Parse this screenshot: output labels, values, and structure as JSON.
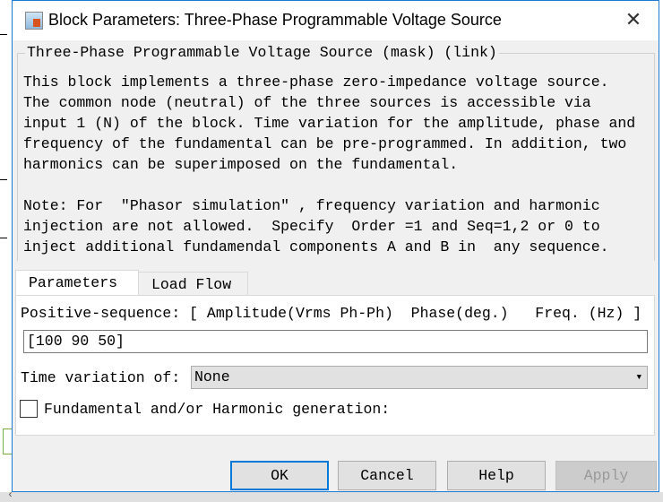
{
  "window": {
    "title": "Block Parameters: Three-Phase Programmable Voltage Source",
    "close_icon": "close-icon"
  },
  "group": {
    "legend": "Three-Phase Programmable Voltage Source (mask) (link)",
    "description": [
      "This block implements a three-phase zero-impedance voltage source.",
      "The common node (neutral) of the three sources is accessible via",
      "input 1 (N) of the block. Time variation for the amplitude, phase and",
      "frequency of the fundamental can be pre-programmed. In addition, two",
      "harmonics can be superimposed on the fundamental.",
      "",
      "Note: For  \"Phasor simulation\" , frequency variation and harmonic",
      "injection are not allowed.  Specify  Order =1 and Seq=1,2 or 0 to",
      "inject additional fundamendal components A and B in  any sequence."
    ]
  },
  "tabs": [
    {
      "label": "Parameters",
      "active": true
    },
    {
      "label": "Load Flow",
      "active": false
    }
  ],
  "params": {
    "positive_sequence_label": "Positive-sequence: [ Amplitude(Vrms Ph-Ph)  Phase(deg.)   Freq. (Hz) ]",
    "positive_sequence_value": "[100 90 50]",
    "time_variation_label": "Time variation of:",
    "time_variation_value": "None",
    "harmonic_label": "Fundamental and/or Harmonic generation:",
    "harmonic_checked": false
  },
  "buttons": {
    "ok": "OK",
    "cancel": "Cancel",
    "help": "Help",
    "apply": "Apply"
  },
  "colors": {
    "focus": "#0078d7",
    "dialog_bg": "#f0f0f0"
  }
}
